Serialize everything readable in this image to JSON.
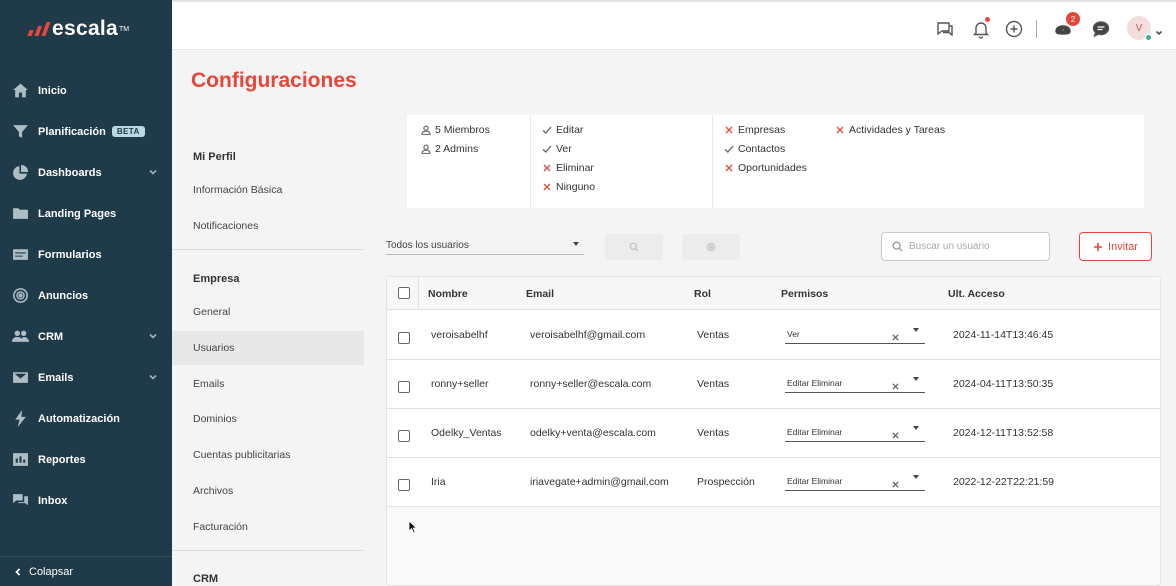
{
  "app": {
    "brand": "escala",
    "brand_mark": "TM",
    "accent_color": "#e5473c",
    "sidebar_color": "#1f3a48"
  },
  "sidebar": {
    "items": [
      {
        "label": "Inicio",
        "icon": "home-icon"
      },
      {
        "label": "Planificación",
        "icon": "funnel-icon",
        "badge": "BETA"
      },
      {
        "label": "Dashboards",
        "icon": "pie-chart-icon",
        "has_submenu": true
      },
      {
        "label": "Landing Pages",
        "icon": "folder-icon"
      },
      {
        "label": "Formularios",
        "icon": "form-icon"
      },
      {
        "label": "Anuncios",
        "icon": "broadcast-icon"
      },
      {
        "label": "CRM",
        "icon": "users-icon",
        "has_submenu": true
      },
      {
        "label": "Emails",
        "icon": "envelope-icon",
        "has_submenu": true
      },
      {
        "label": "Automatización",
        "icon": "lightning-icon"
      },
      {
        "label": "Reportes",
        "icon": "bar-chart-icon"
      },
      {
        "label": "Inbox",
        "icon": "chat-icon"
      }
    ],
    "collapse_label": "Colapsar"
  },
  "topbar": {
    "notifications_badge": "2",
    "avatar_initial": "V"
  },
  "page": {
    "title": "Configuraciones"
  },
  "settings_menu": {
    "mi_perfil": {
      "title": "Mi Perfil",
      "items": [
        "Información Básica",
        "Notificaciones"
      ]
    },
    "empresa": {
      "title": "Empresa",
      "items": [
        "General",
        "Usuarios",
        "Emails",
        "Dominios",
        "Cuentas publicitarias",
        "Archivos",
        "Facturación"
      ],
      "active": "Usuarios"
    },
    "crm": {
      "title": "CRM"
    }
  },
  "summary": {
    "members": "5 Miembros",
    "admins": "2 Admins",
    "actions": [
      {
        "label": "Editar",
        "allowed": true
      },
      {
        "label": "Ver",
        "allowed": true
      },
      {
        "label": "Eliminar",
        "allowed": false
      },
      {
        "label": "Ninguno",
        "allowed": false
      }
    ],
    "modules": [
      {
        "label": "Empresas",
        "allowed": false
      },
      {
        "label": "Contactos",
        "allowed": true
      },
      {
        "label": "Oportunidades",
        "allowed": false
      }
    ],
    "modules2": [
      {
        "label": "Actividades y Tareas",
        "allowed": false
      }
    ]
  },
  "filters": {
    "user_filter": "Todos los usuarios",
    "search_placeholder": "Buscar un usuario",
    "invite_label": "Invitar"
  },
  "table": {
    "headers": [
      "Nombre",
      "Email",
      "Rol",
      "Permisos",
      "Ult. Acceso"
    ],
    "rows": [
      {
        "name": "veroisabelhf",
        "email": "veroisabelhf@gmail.com",
        "role": "Ventas",
        "perms": "Ver",
        "last_access": "2024-11-14T13:46:45"
      },
      {
        "name": "ronny+seller",
        "email": "ronny+seller@escala.com",
        "role": "Ventas",
        "perms": "Editar Eliminar",
        "last_access": "2024-04-11T13:50:35"
      },
      {
        "name": "Odelky_Ventas",
        "email": "odelky+venta@escala.com",
        "role": "Ventas",
        "perms": "Editar Eliminar",
        "last_access": "2024-12-11T13:52:58"
      },
      {
        "name": "Iria",
        "email": "iriavegate+admin@gmail.com",
        "role": "Prospección",
        "perms": "Editar Eliminar",
        "last_access": "2022-12-22T22:21:59"
      }
    ]
  }
}
